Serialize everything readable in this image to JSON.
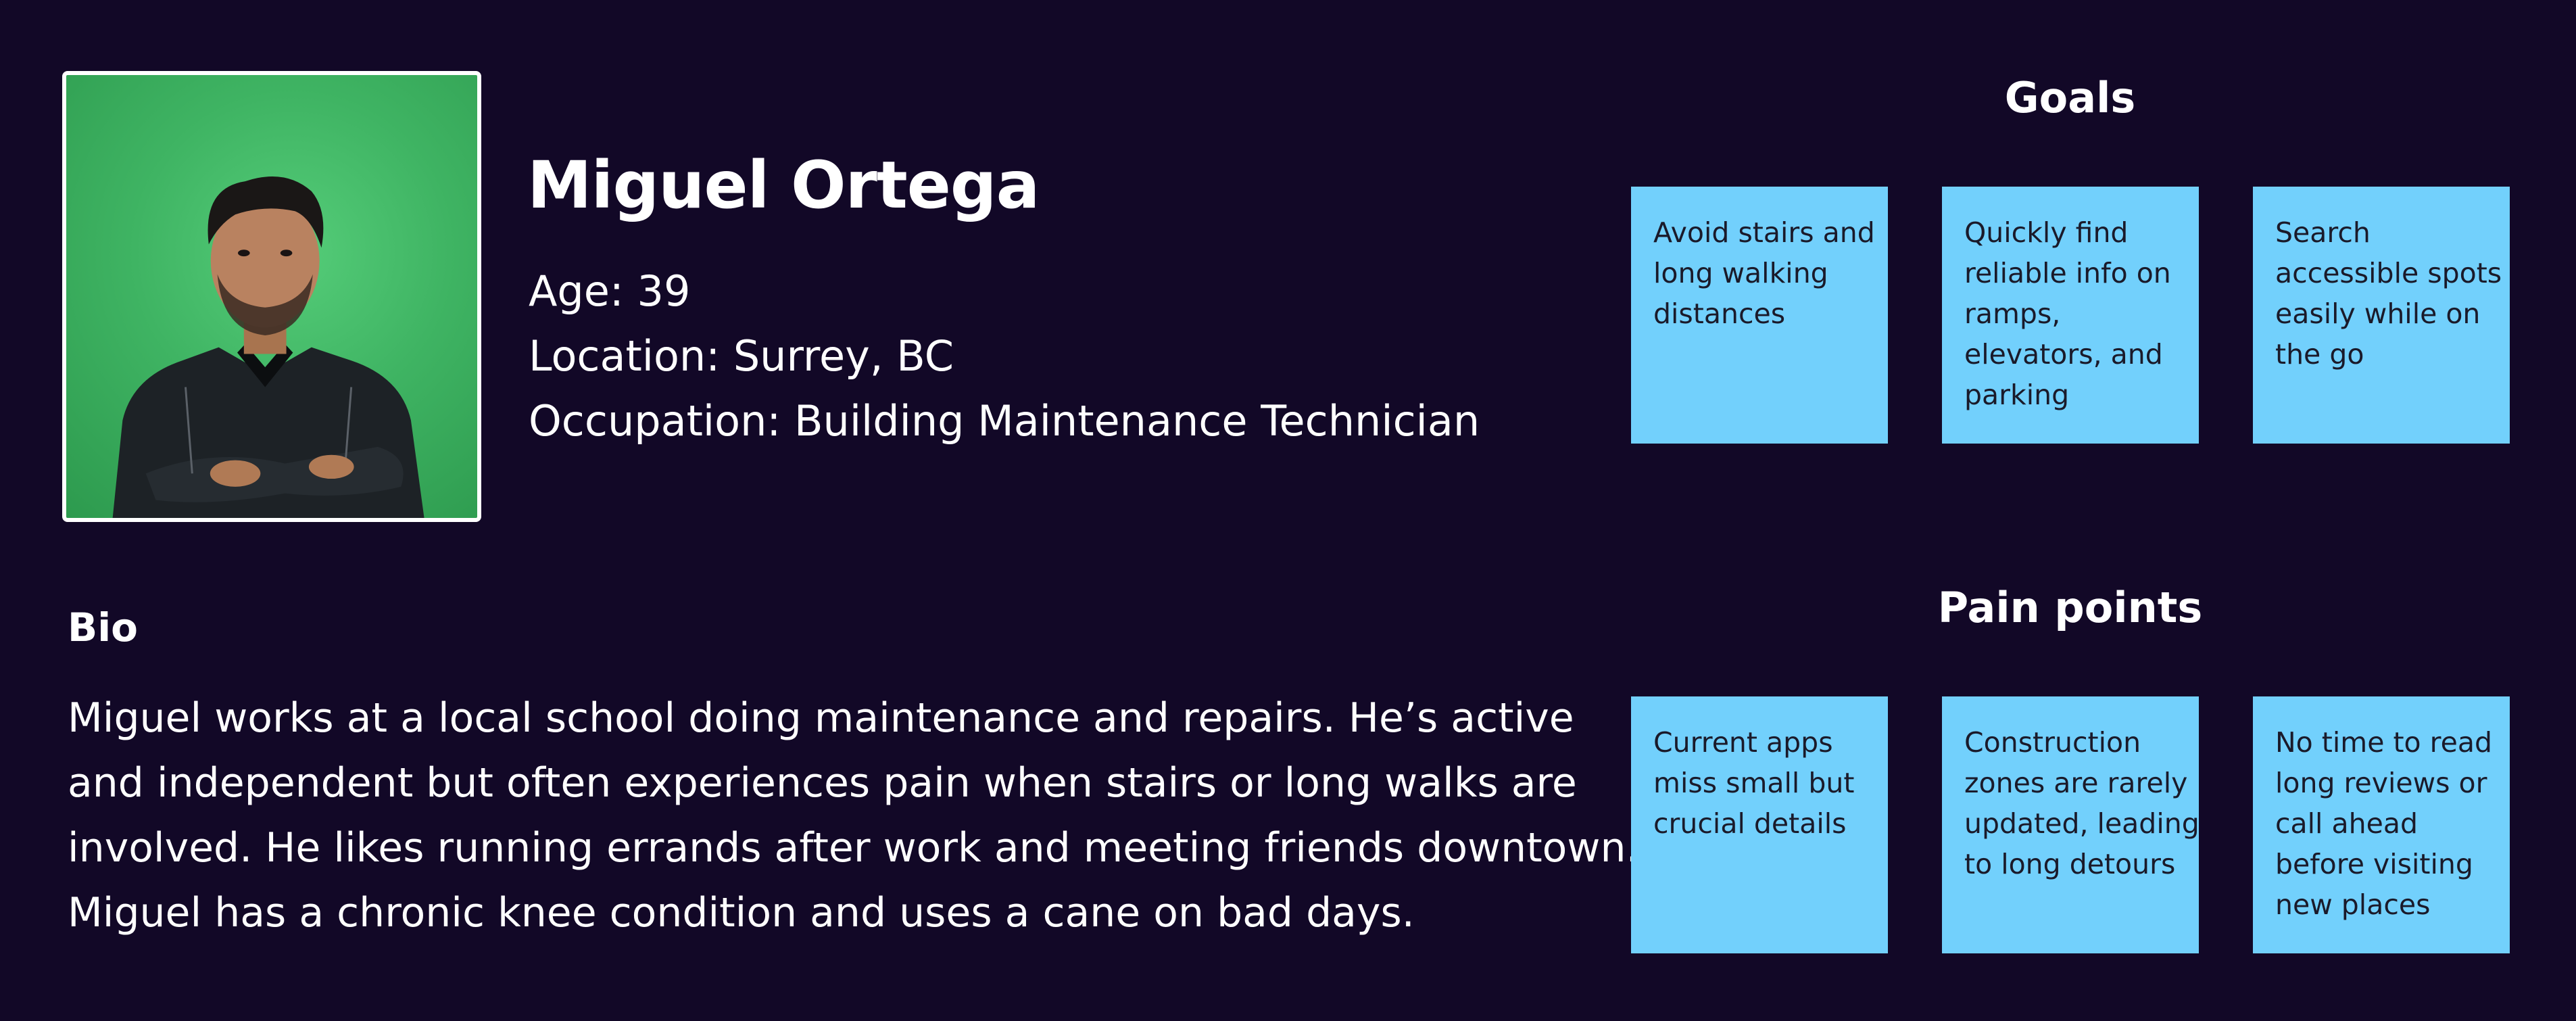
{
  "persona": {
    "name": "Miguel Ortega",
    "age_label": "Age: ",
    "age": "39",
    "location_label": "Location: ",
    "location": "Surrey, BC",
    "occupation_label": "Occupation: ",
    "occupation": "Building Maintenance Technician",
    "photo_icon": "portrait-photo"
  },
  "bio": {
    "heading": "Bio",
    "lines": [
      "Miguel works at a local school doing maintenance and repairs. He’s active",
      "and independent but often experiences pain when stairs or long walks are",
      "involved. He likes running errands after work and meeting friends downtown.",
      "Miguel has a chronic knee condition and uses a cane on bad days."
    ]
  },
  "goals": {
    "title": "Goals",
    "notes": [
      {
        "lines": [
          "Avoid stairs and",
          "long walking",
          "distances"
        ]
      },
      {
        "lines": [
          "Quickly find",
          "reliable info on",
          "ramps,",
          "elevators, and",
          "parking"
        ]
      },
      {
        "lines": [
          "Search",
          "accessible spots",
          "easily while on",
          "the go"
        ]
      }
    ]
  },
  "pain_points": {
    "title": "Pain points",
    "notes": [
      {
        "lines": [
          "Current apps",
          "miss small but",
          "crucial details"
        ]
      },
      {
        "lines": [
          "Construction",
          "zones are rarely",
          "updated, leading",
          "to long detours"
        ]
      },
      {
        "lines": [
          "No time to read",
          "long reviews or",
          "call ahead",
          "before visiting",
          "new places"
        ]
      }
    ]
  },
  "colors": {
    "background": "#120827",
    "sticky_note": "#72d0fc",
    "sticky_text": "#1a1a2a",
    "photo_background": "#3fb463"
  }
}
